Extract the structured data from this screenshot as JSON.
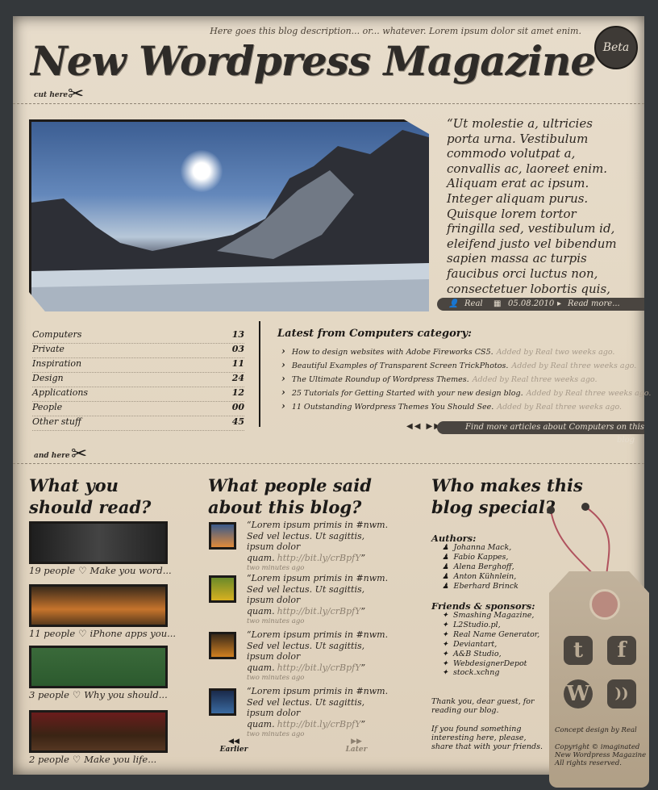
{
  "header": {
    "description": "Here goes this blog description... or... whatever. Lorem ipsum dolor sit amet enim.",
    "title": "New Wordpress Magazine",
    "badge": "Beta",
    "cut_here": "cut here",
    "and_here": "and here"
  },
  "featured": {
    "quote": "“Ut molestie a, ultricies porta urna. Vestibulum commodo volutpat a, convallis ac, laoreet enim. Aliquam erat ac ipsum. Integer aliquam purus. Quisque lorem tortor fringilla sed, vestibulum id, eleifend justo vel bibendum sapien massa ac turpis faucibus orci luctus non, consectetuer lobortis quis, varius in.”",
    "author": "Real",
    "date": "05.08.2010",
    "read_more": "Read more..."
  },
  "categories": [
    {
      "name": "Computers",
      "count": "13"
    },
    {
      "name": "Private",
      "count": "03"
    },
    {
      "name": "Inspiration",
      "count": "11"
    },
    {
      "name": "Design",
      "count": "24"
    },
    {
      "name": "Applications",
      "count": "12"
    },
    {
      "name": "People",
      "count": "00"
    },
    {
      "name": "Other stuff",
      "count": "45"
    }
  ],
  "latest": {
    "title": "Latest from Computers category:",
    "items": [
      {
        "text": "How to design websites with Adobe Fireworks CS5.",
        "by": "Added by Real two weeks ago."
      },
      {
        "text": "Beautiful Examples of Transparent Screen TrickPhotos.",
        "by": "Added by Real three weeks ago."
      },
      {
        "text": "The Ultimate Roundup of Wordpress Themes.",
        "by": "Added by Real three weeks ago."
      },
      {
        "text": "25 Tutorials for Getting Started with your new design blog.",
        "by": "Added by Real three weeks ago."
      },
      {
        "text": "11 Outstanding Wordpress Themes You Should See.",
        "by": "Added by Real three weeks ago."
      }
    ],
    "find_more": "Find more articles about Computers on this blog"
  },
  "read": {
    "title": "What you should read?",
    "items": [
      {
        "people": "19 people",
        "text": "Make you word..."
      },
      {
        "people": "11 people",
        "text": "iPhone apps you..."
      },
      {
        "people": "3 people",
        "text": "Why you should..."
      },
      {
        "people": "2 people",
        "text": "Make you life..."
      }
    ]
  },
  "said": {
    "title": "What people said about this blog?",
    "text": "“Lorem ipsum primis in #nwm. Sed vel lectus. Ut sagittis, ipsum dolor quam.",
    "link": "http://bit.ly/crBpfY",
    "end": "”",
    "ago": "two minutes ago",
    "earlier": "Earlier",
    "later": "Later"
  },
  "who": {
    "title": "Who makes this blog special?",
    "authors_label": "Authors:",
    "authors": [
      "Johanna Mack,",
      "Fabio Kappes,",
      "Alena Berghoff,",
      "Anton Kühnlein,",
      "Eberhard Brinck"
    ],
    "friends_label": "Friends & sponsors:",
    "friends": [
      "Smashing Magazine,",
      "L2Studio.pl,",
      "Real Name Generator,",
      "Deviantart,",
      "A&B Studio,",
      "WebdesignerDepot",
      "stock.xchng"
    ],
    "thanks": "Thank you, dear guest, for reading our blog.",
    "share": "If you found something interesting here, please, share that with your friends."
  },
  "tag": {
    "concept": "Concept design by Real",
    "copyright": "Copyright © imaginated New Wordpress Magazine All rights reserved."
  },
  "colors": {
    "paper": "#e4d8c4",
    "ink": "#1c1a18",
    "bar": "#4a4540"
  }
}
